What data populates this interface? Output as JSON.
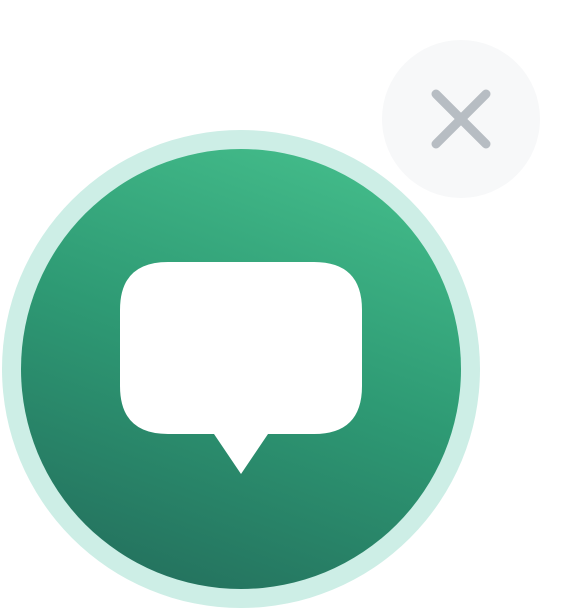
{
  "widget": {
    "close_button": {
      "icon": "close-icon",
      "color": "#b7bdc3",
      "background": "#f7f8f9"
    },
    "launcher": {
      "icon": "chat-bubble-icon",
      "ring_color": "#cdeee6",
      "gradient_start": "#47c28e",
      "gradient_end": "#226a5a",
      "icon_color": "#ffffff"
    }
  }
}
